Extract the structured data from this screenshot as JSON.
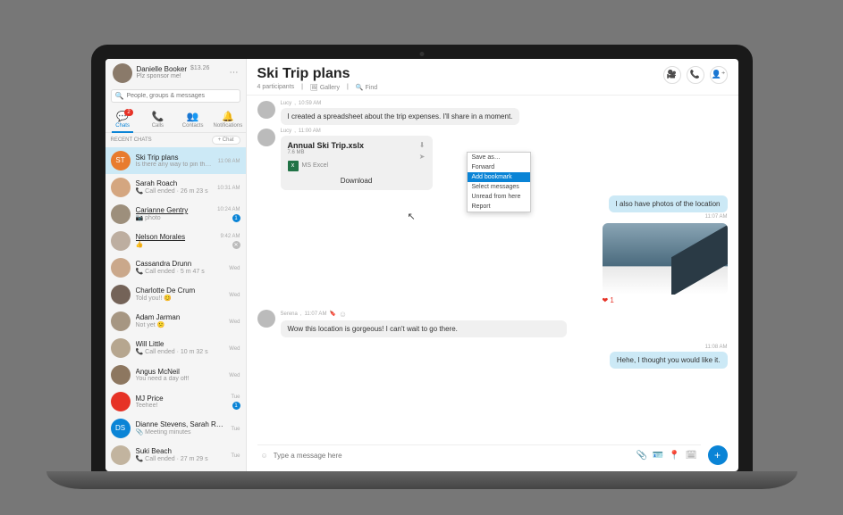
{
  "profile": {
    "name": "Danielle Booker",
    "amount": "$13.26",
    "status": "Plz sponsor me!"
  },
  "search": {
    "placeholder": "People, groups & messages"
  },
  "nav": {
    "items": [
      {
        "label": "Chats",
        "badge": "2"
      },
      {
        "label": "Calls"
      },
      {
        "label": "Contacts"
      },
      {
        "label": "Notifications"
      }
    ]
  },
  "recent_label": "RECENT CHATS",
  "new_chat": "+ Chat",
  "chats": [
    {
      "name": "Ski Trip plans",
      "preview": "Is there any way to pin these…",
      "time": "11:08 AM",
      "avbg": "#e87b2e",
      "initials": "ST",
      "selected": true
    },
    {
      "name": "Sarah Roach",
      "preview": "📞 Call ended · 26 m 23 s",
      "time": "10:31 AM",
      "avbg": "#d4a680"
    },
    {
      "name": "Carianne Gentry",
      "preview": "📷 photo",
      "time": "10:24 AM",
      "avbg": "#9d8f7c",
      "underline": true,
      "badge": "1"
    },
    {
      "name": "Nelson Morales",
      "preview": "👍",
      "time": "9:42 AM",
      "avbg": "#bdaea0",
      "underline": true,
      "muted": true
    },
    {
      "name": "Cassandra Drunn",
      "preview": "📞 Call ended · 5 m 47 s",
      "time": "Wed",
      "avbg": "#caa88b"
    },
    {
      "name": "Charlotte De Crum",
      "preview": "Told you!! 😊",
      "time": "Wed",
      "avbg": "#746358"
    },
    {
      "name": "Adam Jarman",
      "preview": "Not yet 😕",
      "time": "Wed",
      "avbg": "#a69682"
    },
    {
      "name": "Will Little",
      "preview": "📞 Call ended · 10 m 32 s",
      "time": "Wed",
      "avbg": "#b6a68f"
    },
    {
      "name": "Angus McNeil",
      "preview": "You need a day off!",
      "time": "Wed",
      "avbg": "#8d7760"
    },
    {
      "name": "MJ Price",
      "preview": "Teehee!",
      "time": "Tue",
      "avbg": "#e63226",
      "badge": "1"
    },
    {
      "name": "Dianne Stevens, Sarah Roach",
      "preview": "📎 Meeting minutes",
      "time": "Tue",
      "avbg": "#0a84d6",
      "initials": "DS"
    },
    {
      "name": "Suki Beach",
      "preview": "📞 Call ended · 27 m 29 s",
      "time": "Tue",
      "avbg": "#c2b49f"
    }
  ],
  "header": {
    "title": "Ski Trip plans",
    "participants": "4 participants",
    "gallery": "Gallery",
    "find": "Find"
  },
  "messages": {
    "m1": {
      "sender": "Lucy",
      "time": "10:59 AM",
      "text": "I created a spreadsheet about the trip expenses. I'll share in a moment."
    },
    "m2": {
      "sender": "Lucy",
      "time": "11:00 AM",
      "file": "Annual Ski Trip.xslx",
      "size": "7.6 MB",
      "kind": "MS Excel",
      "download": "Download"
    },
    "m3": {
      "text": "I also have photos of the location",
      "time": "11:07 AM"
    },
    "m4": {
      "reaction": "❤ 1"
    },
    "m5": {
      "sender": "Serena",
      "time": "11:07 AM",
      "text": "Wow this location is gorgeous! I can't wait to go there."
    },
    "m6": {
      "text": "Hehe, I thought you would like it.",
      "time": "11:08 AM"
    }
  },
  "context": [
    "Save as…",
    "Forward",
    "Add bookmark",
    "Select messages",
    "Unread from here",
    "Report"
  ],
  "composer": {
    "placeholder": "Type a message here"
  }
}
